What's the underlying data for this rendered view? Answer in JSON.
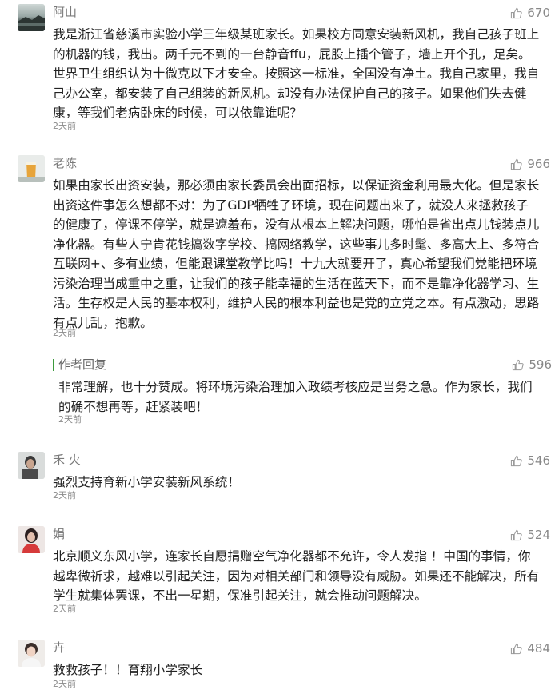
{
  "comments": [
    {
      "name": "阿山",
      "likes": "670",
      "body": "我是浙江省慈溪市实验小学三年级某班家长。如果校方同意安装新风机，我自己孩子班上\n的机器的钱，我出。两千元不到的一台静音ffu，屁股上插个管子，墙上开个孔，足矣。\n世界卫生组织认为十微克以下才安全。按照这一标准，全国没有净土。我自己家里，我自\n己办公室，都安装了自己组装的新风机。却没有办法保护自己的孩子。如果他们失去健\n康，等我们老病卧床的时候，可以依靠谁呢？",
      "time": "2天前"
    },
    {
      "name": "老陈",
      "likes": "966",
      "body": "如果由家长出资安装，那必须由家长委员会出面招标，以保证资金利用最大化。但是家长\n出资这件事怎么想都不对：为了GDP牺牲了环境，现在问题出来了，就没人来拯救孩子\n的健康了，停课不停学，就是遮羞布，没有从根本上解决问题，哪怕是省出点儿钱装点儿\n净化器。有些人宁肯花钱搞数字学校、搞网络教学，这些事儿多时髦、多高大上、多符合\n互联网+、多有业绩，但能跟课堂教学比吗！十九大就要开了，真心希望我们党能把环境\n污染治理当成重中之重，让我们的孩子能幸福的生活在蓝天下，而不是靠净化器学习、生\n活。生存权是人民的基本权利，维护人民的根本利益也是党的立党之本。有点激动，思路\n有点儿乱，抱歉。",
      "time": "2天前",
      "reply": {
        "title": "作者回复",
        "likes": "596",
        "body": "非常理解，也十分赞成。将环境污染治理加入政绩考核应是当务之急。作为家长，我们\n的确不想再等，赶紧装吧！",
        "time": "2天前"
      }
    },
    {
      "name": "禾  火",
      "likes": "546",
      "body": "强烈支持育新小学安装新风系统！",
      "time": "2天前"
    },
    {
      "name": "娟",
      "likes": "524",
      "body": "北京顺义东风小学，连家长自愿捐赠空气净化器都不允许，令人发指 ！中国的事情，你\n越卑微祈求，越难以引起关注，因为对相关部门和领导没有威胁。如果还不能解决，所有\n学生就集体罢课，不出一星期，保准引起关注，就会推动问题解决。",
      "time": "2天前"
    },
    {
      "name": "卉",
      "likes": "484",
      "body": "救救孩子！！育翔小学家长",
      "time": "2天前"
    }
  ]
}
